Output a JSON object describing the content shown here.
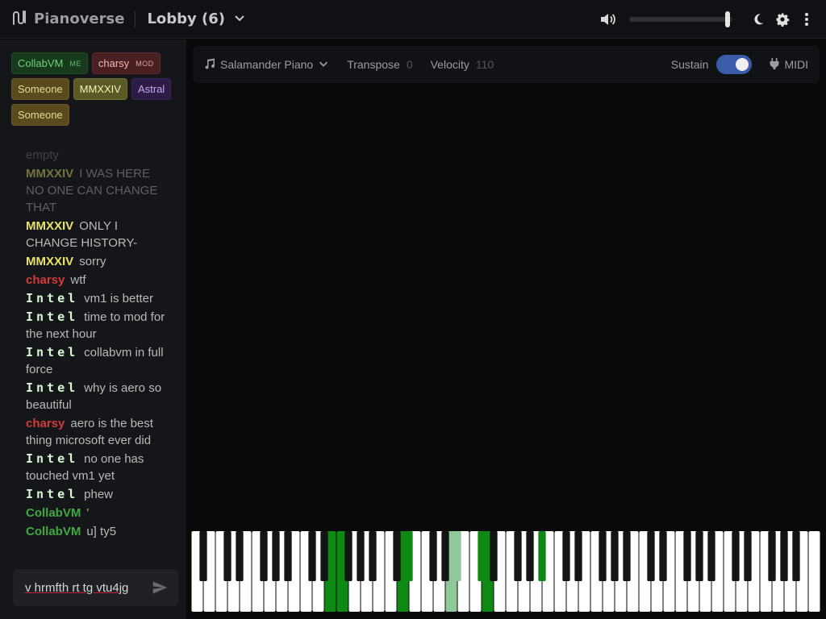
{
  "app": {
    "name": "Pianoverse",
    "room": "Lobby (6)"
  },
  "topbar": {
    "volume_level": 0.95
  },
  "users": [
    {
      "name": "CollabVM",
      "tag": "ME",
      "color": "green"
    },
    {
      "name": "charsy",
      "tag": "MOD",
      "color": "red"
    },
    {
      "name": "Someone",
      "tag": "",
      "color": "gold"
    },
    {
      "name": "MMXXIV",
      "tag": "",
      "color": "olive"
    },
    {
      "name": "Astral",
      "tag": "",
      "color": "purple"
    },
    {
      "name": "Someone",
      "tag": "",
      "color": "gold"
    }
  ],
  "chat": {
    "messages": [
      {
        "who": "",
        "text": "empty",
        "who_color": "#555555",
        "style": "empty"
      },
      {
        "who": "MMXXIV",
        "text": "I WAS HERE NO ONE CAN CHANGE THAT",
        "who_color": "#e8e26a",
        "style": "faded"
      },
      {
        "who": "MMXXIV",
        "text": "ONLY I CHANGE HISTORY-",
        "who_color": "#e8e26a",
        "style": ""
      },
      {
        "who": "MMXXIV",
        "text": "sorry",
        "who_color": "#e8e26a",
        "style": ""
      },
      {
        "who": "charsy",
        "text": "wtf",
        "who_color": "#d13b3b",
        "style": ""
      },
      {
        "who": "Intel",
        "text": "vm1 is better",
        "who_color": "#d6f7d0",
        "style": "intel"
      },
      {
        "who": "Intel",
        "text": "time to mod for the next hour",
        "who_color": "#d6f7d0",
        "style": "intel"
      },
      {
        "who": "Intel",
        "text": "collabvm in full force",
        "who_color": "#d6f7d0",
        "style": "intel"
      },
      {
        "who": "Intel",
        "text": "why is aero so beautiful",
        "who_color": "#d6f7d0",
        "style": "intel"
      },
      {
        "who": "charsy",
        "text": "aero is the best thing microsoft ever did",
        "who_color": "#d13b3b",
        "style": ""
      },
      {
        "who": "Intel",
        "text": "no one has touched vm1 yet",
        "who_color": "#d6f7d0",
        "style": "intel"
      },
      {
        "who": "Intel",
        "text": "phew",
        "who_color": "#d6f7d0",
        "style": "intel"
      },
      {
        "who": "CollabVM",
        "text": "'",
        "who_color": "#3fa83f",
        "style": ""
      },
      {
        "who": "CollabVM",
        "text": "u] ty5",
        "who_color": "#3fa83f",
        "style": ""
      }
    ],
    "input_value": "v hrmfth rt tg vtu4jg"
  },
  "toolbar": {
    "instrument": "Salamander Piano",
    "transpose_label": "Transpose",
    "transpose_value": "0",
    "velocity_label": "Velocity",
    "velocity_value": "110",
    "sustain_label": "Sustain",
    "sustain_on": true,
    "midi_label": "MIDI"
  },
  "piano": {
    "pressed_white": [
      11,
      12,
      17,
      21,
      24
    ],
    "pressed_white_light": [
      21
    ],
    "pressed_black": [
      11,
      17,
      23,
      25,
      28
    ],
    "pressed_black_light": [
      21
    ]
  },
  "colors": {
    "accent": "#3b5ca8",
    "pressed": "#0e8a14",
    "pressed_light": "#8fc99a"
  }
}
